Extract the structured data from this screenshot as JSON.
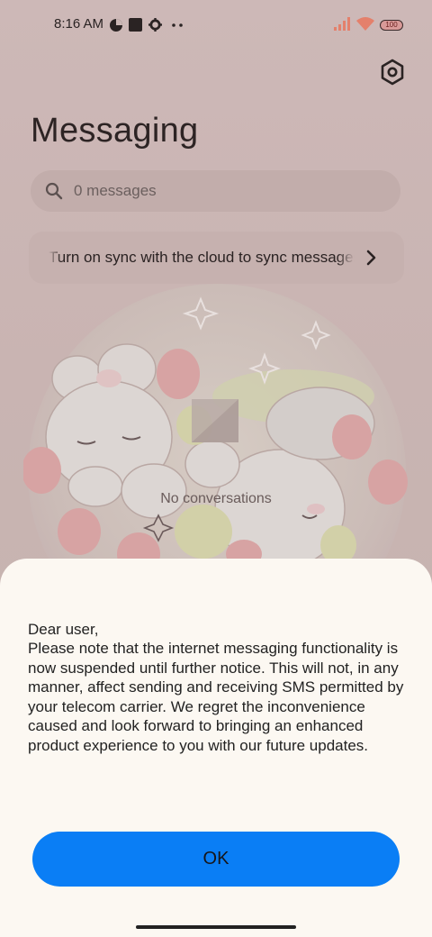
{
  "status_bar": {
    "time": "8:16 AM",
    "icons": [
      "data-saver-icon",
      "stop-square-icon",
      "gear-icon",
      "more-dots-icon",
      "signal-icon",
      "wifi-icon"
    ],
    "battery": "100"
  },
  "header": {
    "title": "Messaging",
    "settings_icon": "hexagon-settings-icon"
  },
  "search": {
    "placeholder": "0 messages"
  },
  "sync_banner": {
    "text": "Turn on sync with the cloud to sync messages"
  },
  "empty_state": {
    "text": "No conversations"
  },
  "dialog": {
    "greeting": "Dear user,",
    "body": "Please note that the internet messaging functionality is now suspended until further notice. This will not, in any manner, affect sending and receiving SMS permitted by your telecom carrier. We regret the inconvenience caused and look forward to bringing an enhanced product experience to you with our future updates.",
    "ok_label": "OK"
  },
  "colors": {
    "accent": "#0a7ef5",
    "sheet_bg": "#fcf8f2",
    "scrim": "#cbb7b5"
  }
}
